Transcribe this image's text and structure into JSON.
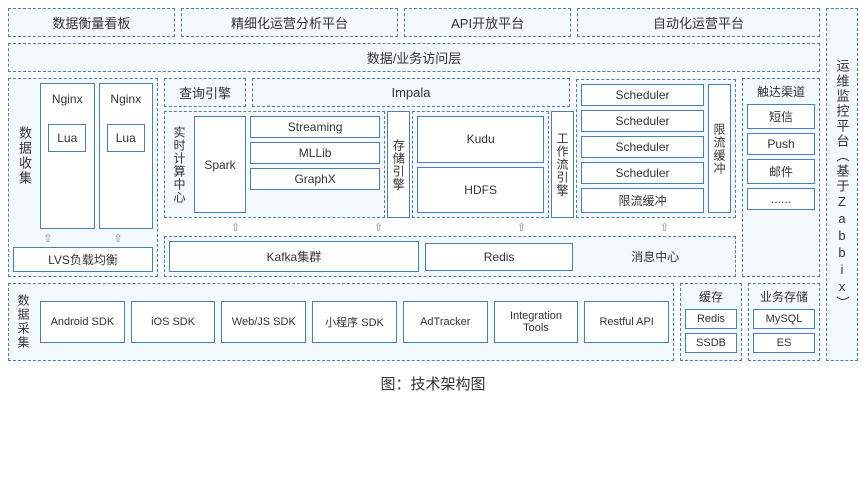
{
  "caption": "图：技术架构图",
  "top": {
    "dashboard": "数据衡量看板",
    "analytics": "精细化运营分析平台",
    "api": "API开放平台",
    "automation": "自动化运营平台"
  },
  "ops": {
    "title": "运维监控平台（基于Zabbix）"
  },
  "access_layer": "数据/业务访问层",
  "query_engine": "查询引擎",
  "impala": "Impala",
  "scheduler": "Scheduler",
  "ratelimit_buffer": "限流缓冲",
  "workflow_engine": "工作流引擎",
  "channels": {
    "title": "触达渠道",
    "sms": "短信",
    "push": "Push",
    "mail": "邮件",
    "more": "......"
  },
  "collect": {
    "title": "数据收集",
    "nginx": "Nginx",
    "lua": "Lua",
    "lvs": "LVS负载均衡"
  },
  "realtime": "实时计算中心",
  "spark": "Spark",
  "streaming": "Streaming",
  "mllib": "MLLib",
  "graphx": "GraphX",
  "storage_engine": "存储引擎",
  "kudu": "Kudu",
  "hdfs": "HDFS",
  "kafka": "Kafka集群",
  "redis": "Redis",
  "msgcenter": "消息中心",
  "cache": {
    "title": "缓存",
    "redis": "Redis",
    "ssdb": "SSDB"
  },
  "bizstore": {
    "title": "业务存储",
    "mysql": "MySQL",
    "es": "ES"
  },
  "ingest": {
    "title": "数据采集",
    "android": "Android SDK",
    "ios": "iOS SDK",
    "webjs": "Web/JS SDK",
    "miniapp": "小程序 SDK",
    "adtracker": "AdTracker",
    "integration": "Integration Tools",
    "restful": "Restful API"
  }
}
